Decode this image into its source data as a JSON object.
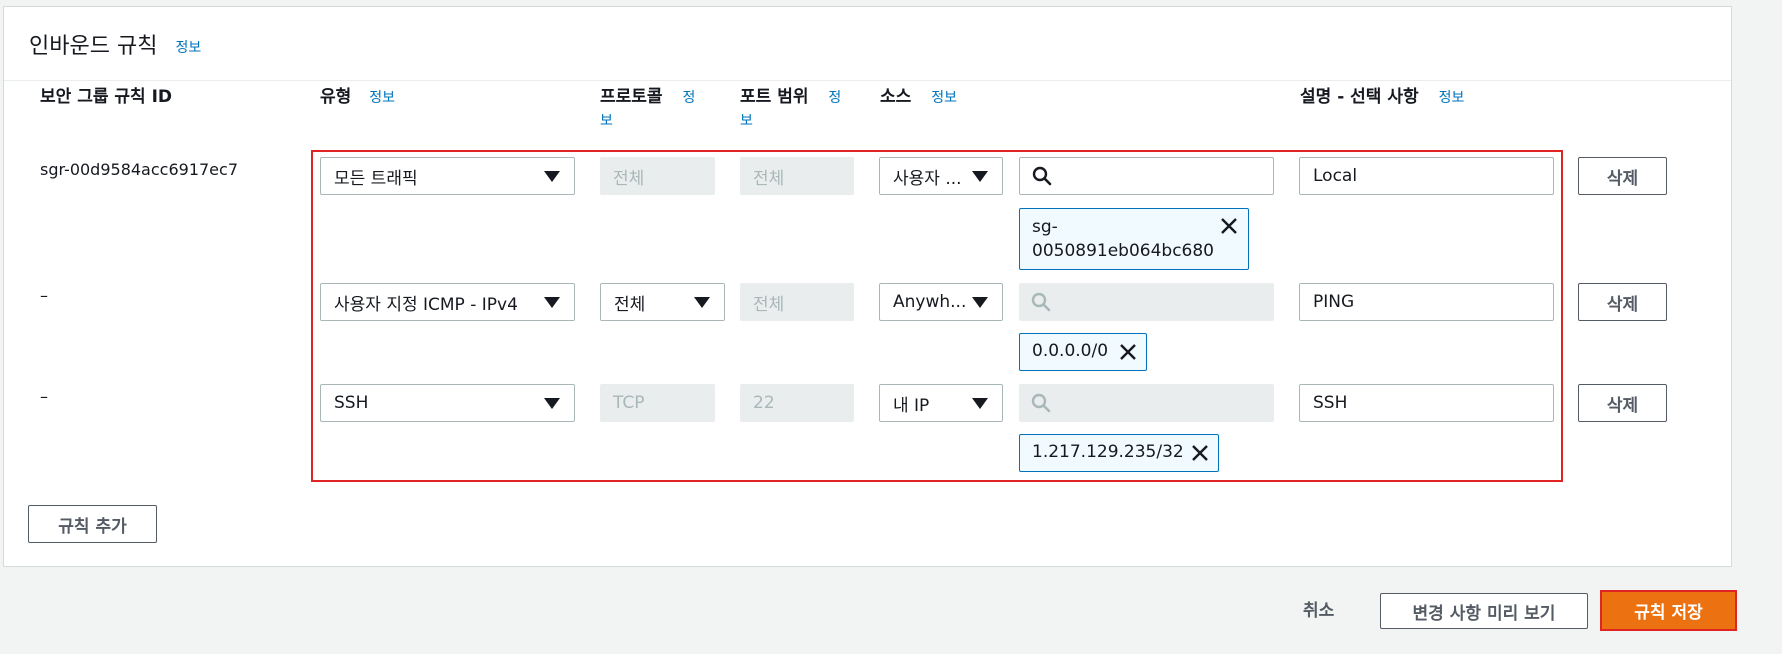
{
  "section": {
    "title": "인바운드 규칙",
    "info": "정보"
  },
  "columns": {
    "rule_id": "보안 그룹 규칙 ID",
    "type": "유형",
    "type_info": "정보",
    "protocol": "프로토콜",
    "protocol_info_1": "정",
    "protocol_info_2": "보",
    "port": "포트 범위",
    "port_info_1": "정",
    "port_info_2": "보",
    "source": "소스",
    "source_info": "정보",
    "description": "설명 - 선택 사항",
    "description_info": "정보"
  },
  "rules": [
    {
      "id": "sgr-00d9584acc6917ec7",
      "type": "모든 트래픽",
      "protocol": "전체",
      "port": "전체",
      "source_type": "사용자 ...",
      "source_token_1": "sg-",
      "source_token_2": "0050891eb064bc680",
      "description": "Local",
      "delete": "삭제"
    },
    {
      "id": "–",
      "type": "사용자 지정 ICMP - IPv4",
      "protocol": "전체",
      "port": "전체",
      "source_type": "Anywh...",
      "source_token": "0.0.0.0/0",
      "description": "PING",
      "delete": "삭제"
    },
    {
      "id": "–",
      "type": "SSH",
      "protocol": "TCP",
      "port": "22",
      "source_type": "내 IP",
      "source_token": "1.217.129.235/32",
      "description": "SSH",
      "delete": "삭제"
    }
  ],
  "add_rule": "규칙 추가",
  "footer": {
    "cancel": "취소",
    "preview": "변경 사항 미리 보기",
    "save": "규칙 저장"
  },
  "colors": {
    "primary": "#ec7211",
    "info_link": "#0073bb",
    "highlight": "#e02424",
    "token_border": "#0073bb"
  },
  "icons": [
    "search-icon",
    "close-icon",
    "caret-down-icon"
  ]
}
